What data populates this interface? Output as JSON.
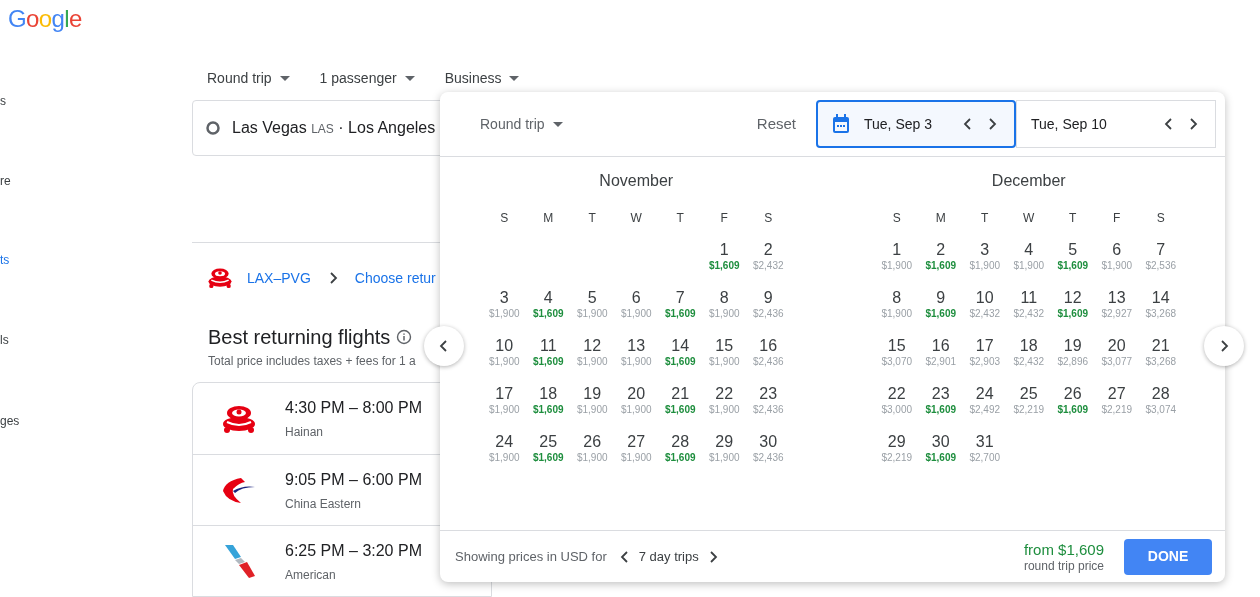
{
  "logo": "Google",
  "sidebar_fragments": [
    {
      "text": "s",
      "selected": false
    },
    {
      "text": "re",
      "selected": false
    },
    {
      "text": "ts",
      "selected": true
    },
    {
      "text": "ls",
      "selected": false
    },
    {
      "text": "ges",
      "selected": false
    }
  ],
  "search_options": [
    "Round trip",
    "1 passenger",
    "Business"
  ],
  "route_field": {
    "origin": "Las Vegas",
    "origin_code": "LAS",
    "separator": "·",
    "destination": "Los Angeles"
  },
  "breadcrumb": {
    "outbound": "LAX–PVG",
    "next": "Choose retur"
  },
  "results": {
    "title": "Best returning flights",
    "subtitle": "Total price includes taxes + fees for 1 a",
    "flights": [
      {
        "airline": "Hainan",
        "kind": "hainan",
        "times": "4:30 PM – 8:00 PM"
      },
      {
        "airline": "China Eastern",
        "kind": "eastern",
        "times": "9:05 PM – 6:00 PM"
      },
      {
        "airline": "American",
        "kind": "american",
        "times": "6:25 PM – 3:20 PM"
      }
    ]
  },
  "date_picker": {
    "trip_type": "Round trip",
    "reset": "Reset",
    "departure": {
      "value": "Tue, Sep 3",
      "selected": true
    },
    "return": {
      "value": "Tue, Sep 10",
      "selected": false
    },
    "months": [
      {
        "name": "November",
        "weekdays": [
          "S",
          "M",
          "T",
          "W",
          "T",
          "F",
          "S"
        ],
        "weeks": [
          [
            {
              "kind": "blank"
            },
            {
              "kind": "blank"
            },
            {
              "kind": "blank"
            },
            {
              "kind": "blank"
            },
            {
              "kind": "blank"
            },
            {
              "day": "1",
              "price": "$1,609",
              "cheapest": true
            },
            {
              "day": "2",
              "price": "$2,432",
              "cheapest": false
            }
          ],
          [
            {
              "day": "3",
              "price": "$1,900",
              "cheapest": false
            },
            {
              "day": "4",
              "price": "$1,609",
              "cheapest": true
            },
            {
              "day": "5",
              "price": "$1,900",
              "cheapest": false
            },
            {
              "day": "6",
              "price": "$1,900",
              "cheapest": false
            },
            {
              "day": "7",
              "price": "$1,609",
              "cheapest": true
            },
            {
              "day": "8",
              "price": "$1,900",
              "cheapest": false
            },
            {
              "day": "9",
              "price": "$2,436",
              "cheapest": false
            }
          ],
          [
            {
              "day": "10",
              "price": "$1,900",
              "cheapest": false
            },
            {
              "day": "11",
              "price": "$1,609",
              "cheapest": true
            },
            {
              "day": "12",
              "price": "$1,900",
              "cheapest": false
            },
            {
              "day": "13",
              "price": "$1,900",
              "cheapest": false
            },
            {
              "day": "14",
              "price": "$1,609",
              "cheapest": true
            },
            {
              "day": "15",
              "price": "$1,900",
              "cheapest": false
            },
            {
              "day": "16",
              "price": "$2,436",
              "cheapest": false
            }
          ],
          [
            {
              "day": "17",
              "price": "$1,900",
              "cheapest": false
            },
            {
              "day": "18",
              "price": "$1,609",
              "cheapest": true
            },
            {
              "day": "19",
              "price": "$1,900",
              "cheapest": false
            },
            {
              "day": "20",
              "price": "$1,900",
              "cheapest": false
            },
            {
              "day": "21",
              "price": "$1,609",
              "cheapest": true
            },
            {
              "day": "22",
              "price": "$1,900",
              "cheapest": false
            },
            {
              "day": "23",
              "price": "$2,436",
              "cheapest": false
            }
          ],
          [
            {
              "day": "24",
              "price": "$1,900",
              "cheapest": false
            },
            {
              "day": "25",
              "price": "$1,609",
              "cheapest": true
            },
            {
              "day": "26",
              "price": "$1,900",
              "cheapest": false
            },
            {
              "day": "27",
              "price": "$1,900",
              "cheapest": false
            },
            {
              "day": "28",
              "price": "$1,609",
              "cheapest": true
            },
            {
              "day": "29",
              "price": "$1,900",
              "cheapest": false
            },
            {
              "day": "30",
              "price": "$2,436",
              "cheapest": false
            }
          ]
        ]
      },
      {
        "name": "December",
        "weekdays": [
          "S",
          "M",
          "T",
          "W",
          "T",
          "F",
          "S"
        ],
        "weeks": [
          [
            {
              "day": "1",
              "price": "$1,900",
              "cheapest": false
            },
            {
              "day": "2",
              "price": "$1,609",
              "cheapest": true
            },
            {
              "day": "3",
              "price": "$1,900",
              "cheapest": false
            },
            {
              "day": "4",
              "price": "$1,900",
              "cheapest": false
            },
            {
              "day": "5",
              "price": "$1,609",
              "cheapest": true
            },
            {
              "day": "6",
              "price": "$1,900",
              "cheapest": false
            },
            {
              "day": "7",
              "price": "$2,536",
              "cheapest": false
            }
          ],
          [
            {
              "day": "8",
              "price": "$1,900",
              "cheapest": false
            },
            {
              "day": "9",
              "price": "$1,609",
              "cheapest": true
            },
            {
              "day": "10",
              "price": "$2,432",
              "cheapest": false
            },
            {
              "day": "11",
              "price": "$2,432",
              "cheapest": false
            },
            {
              "day": "12",
              "price": "$1,609",
              "cheapest": true
            },
            {
              "day": "13",
              "price": "$2,927",
              "cheapest": false
            },
            {
              "day": "14",
              "price": "$3,268",
              "cheapest": false
            }
          ],
          [
            {
              "day": "15",
              "price": "$3,070",
              "cheapest": false
            },
            {
              "day": "16",
              "price": "$2,901",
              "cheapest": false
            },
            {
              "day": "17",
              "price": "$2,903",
              "cheapest": false
            },
            {
              "day": "18",
              "price": "$2,432",
              "cheapest": false
            },
            {
              "day": "19",
              "price": "$2,896",
              "cheapest": false
            },
            {
              "day": "20",
              "price": "$3,077",
              "cheapest": false
            },
            {
              "day": "21",
              "price": "$3,268",
              "cheapest": false
            }
          ],
          [
            {
              "day": "22",
              "price": "$3,000",
              "cheapest": false
            },
            {
              "day": "23",
              "price": "$1,609",
              "cheapest": true
            },
            {
              "day": "24",
              "price": "$2,492",
              "cheapest": false
            },
            {
              "day": "25",
              "price": "$2,219",
              "cheapest": false
            },
            {
              "day": "26",
              "price": "$1,609",
              "cheapest": true
            },
            {
              "day": "27",
              "price": "$2,219",
              "cheapest": false
            },
            {
              "day": "28",
              "price": "$3,074",
              "cheapest": false
            }
          ],
          [
            {
              "day": "29",
              "price": "$2,219",
              "cheapest": false
            },
            {
              "day": "30",
              "price": "$1,609",
              "cheapest": true
            },
            {
              "day": "31",
              "price": "$2,700",
              "cheapest": false
            }
          ]
        ]
      }
    ],
    "footer": {
      "note": "Showing prices in USD for",
      "trip_length": "7 day trips",
      "from_price": "from $1,609",
      "price_caption": "round trip price",
      "done": "DONE"
    }
  }
}
